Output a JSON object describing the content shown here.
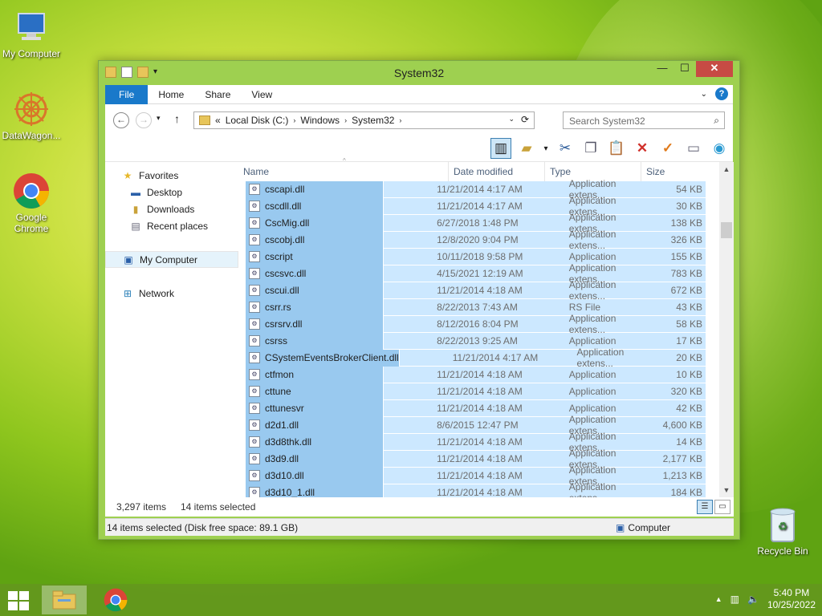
{
  "desktop": {
    "icons": [
      {
        "label": "My Computer"
      },
      {
        "label": "DataWagon..."
      },
      {
        "label": "Google Chrome"
      },
      {
        "label": "Recycle Bin"
      }
    ]
  },
  "window": {
    "title": "System32",
    "ribbon_tabs": [
      "File",
      "Home",
      "Share",
      "View"
    ],
    "breadcrumb": [
      "«",
      "Local Disk (C:)",
      "Windows",
      "System32"
    ],
    "search_placeholder": "Search System32",
    "nav": {
      "favorites": "Favorites",
      "desktop": "Desktop",
      "downloads": "Downloads",
      "recent": "Recent places",
      "my_computer": "My Computer",
      "network": "Network"
    },
    "columns": [
      "Name",
      "Date modified",
      "Type",
      "Size"
    ],
    "rows": [
      {
        "name": "cscapi.dll",
        "date": "11/21/2014 4:17 AM",
        "type": "Application extens...",
        "size": "54 KB"
      },
      {
        "name": "cscdll.dll",
        "date": "11/21/2014 4:17 AM",
        "type": "Application extens...",
        "size": "30 KB"
      },
      {
        "name": "CscMig.dll",
        "date": "6/27/2018 1:48 PM",
        "type": "Application extens...",
        "size": "138 KB"
      },
      {
        "name": "cscobj.dll",
        "date": "12/8/2020 9:04 PM",
        "type": "Application extens...",
        "size": "326 KB"
      },
      {
        "name": "cscript",
        "date": "10/11/2018 9:58 PM",
        "type": "Application",
        "size": "155 KB"
      },
      {
        "name": "cscsvc.dll",
        "date": "4/15/2021 12:19 AM",
        "type": "Application extens...",
        "size": "783 KB"
      },
      {
        "name": "cscui.dll",
        "date": "11/21/2014 4:18 AM",
        "type": "Application extens...",
        "size": "672 KB"
      },
      {
        "name": "csrr.rs",
        "date": "8/22/2013 7:43 AM",
        "type": "RS File",
        "size": "43 KB"
      },
      {
        "name": "csrsrv.dll",
        "date": "8/12/2016 8:04 PM",
        "type": "Application extens...",
        "size": "58 KB"
      },
      {
        "name": "csrss",
        "date": "8/22/2013 9:25 AM",
        "type": "Application",
        "size": "17 KB"
      },
      {
        "name": "CSystemEventsBrokerClient.dll",
        "date": "11/21/2014 4:17 AM",
        "type": "Application extens...",
        "size": "20 KB"
      },
      {
        "name": "ctfmon",
        "date": "11/21/2014 4:18 AM",
        "type": "Application",
        "size": "10 KB"
      },
      {
        "name": "cttune",
        "date": "11/21/2014 4:18 AM",
        "type": "Application",
        "size": "320 KB"
      },
      {
        "name": "cttunesvr",
        "date": "11/21/2014 4:18 AM",
        "type": "Application",
        "size": "42 KB"
      },
      {
        "name": "d2d1.dll",
        "date": "8/6/2015 12:47 PM",
        "type": "Application extens...",
        "size": "4,600 KB"
      },
      {
        "name": "d3d8thk.dll",
        "date": "11/21/2014 4:18 AM",
        "type": "Application extens...",
        "size": "14 KB"
      },
      {
        "name": "d3d9.dll",
        "date": "11/21/2014 4:18 AM",
        "type": "Application extens...",
        "size": "2,177 KB"
      },
      {
        "name": "d3d10.dll",
        "date": "11/21/2014 4:18 AM",
        "type": "Application extens...",
        "size": "1,213 KB"
      },
      {
        "name": "d3d10_1.dll",
        "date": "11/21/2014 4:18 AM",
        "type": "Application extens...",
        "size": "184 KB"
      }
    ],
    "item_count": "3,297 items",
    "selected_count": "14 items selected",
    "status_left": "14 items selected (Disk free space: 89.1 GB)",
    "status_right": "Computer"
  },
  "taskbar": {
    "time": "5:40 PM",
    "date": "10/25/2022"
  },
  "colors": {
    "accent": "#1979ca",
    "selection": "#cce8ff",
    "selection_name": "#99c9ef"
  }
}
